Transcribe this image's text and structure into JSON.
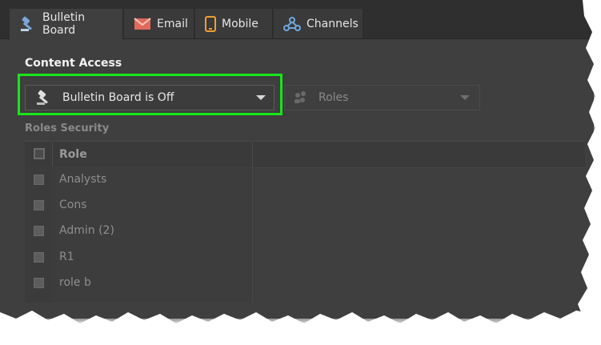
{
  "tabs": [
    {
      "label": "Bulletin Board",
      "icon": "gavel-icon",
      "active": true
    },
    {
      "label": "Email",
      "icon": "envelope-icon",
      "active": false
    },
    {
      "label": "Mobile",
      "icon": "mobile-icon",
      "active": false
    },
    {
      "label": "Channels",
      "icon": "webhook-icon",
      "active": false
    }
  ],
  "content_access": {
    "title": "Content Access",
    "dropdown_value": "Bulletin Board is Off",
    "roles_placeholder": "Roles"
  },
  "roles_security": {
    "title": "Roles Security",
    "header": "Role",
    "rows": [
      "Analysts",
      "Cons",
      "Admin (2)",
      "R1",
      "role b"
    ]
  },
  "colors": {
    "accent_highlight": "#18e51a",
    "panel_bg": "#3f3f3f",
    "email_icon": "#e06a5b",
    "mobile_icon": "#f0a030",
    "channels_icon": "#6fa8dc"
  }
}
